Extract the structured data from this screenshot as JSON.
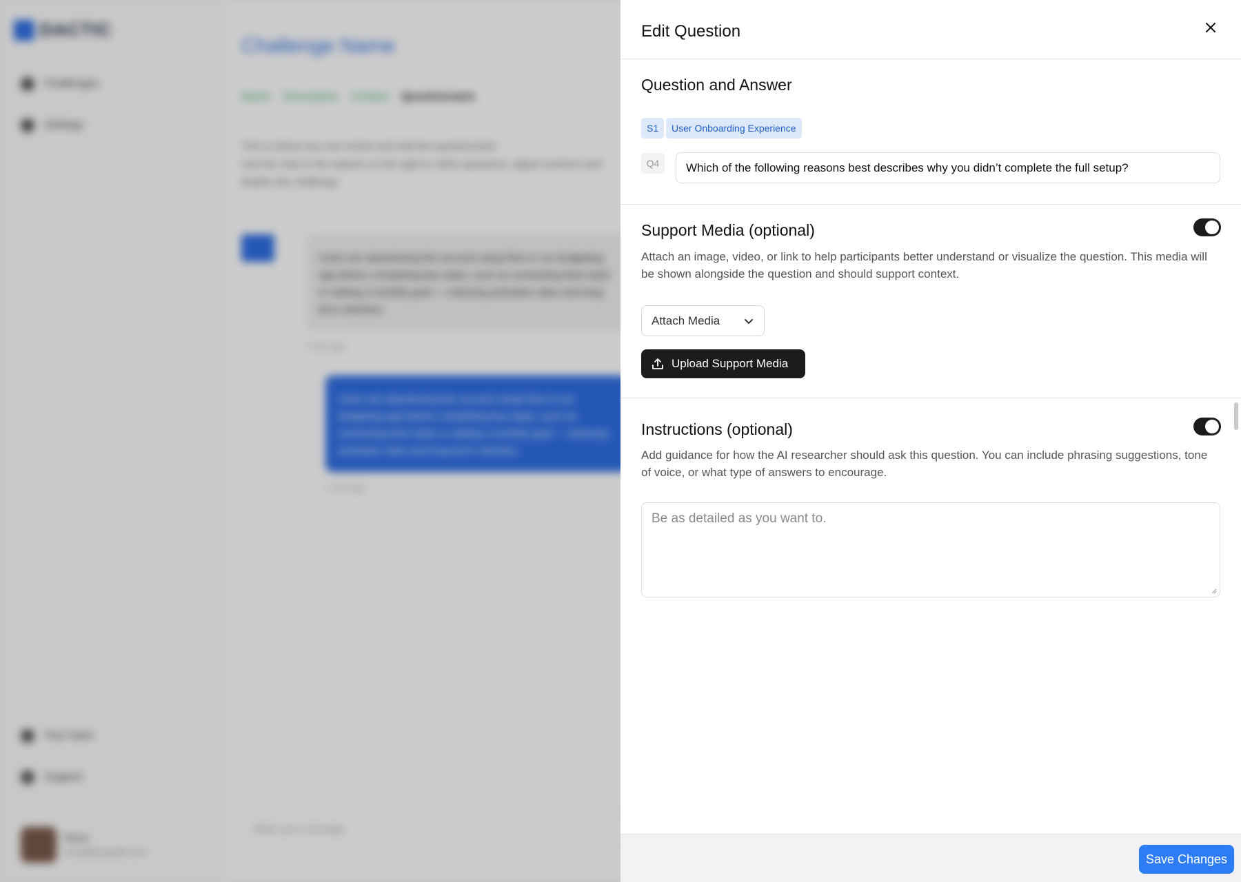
{
  "background": {
    "logo_text": "DACTIC",
    "nav_challenges": "Challenges",
    "nav_settings": "Settings",
    "nav_team": "Your team",
    "nav_support": "Support",
    "user_name": "Erica",
    "user_email": "erica@example.com",
    "page_title": "Challenge Name",
    "steps": [
      "Name",
      "Description",
      "Context",
      "Questionnaire"
    ],
    "desc_line1": "This is where you can review and edit the questionnaire.",
    "desc_line2": "Use the chat or the options on the right to refine questions, adjust sections and finalize the challenge.",
    "bot_message": "Users are abandoning the account setup flow in our budgeting app before completing key steps, such as connecting their bank or setting a monthly goal — reducing activation rates and long-term retention.",
    "user_message": "Users are abandoning the account setup flow in our budgeting app before completing key steps, such as connecting their bank or setting a monthly goal — reducing activation rates and long-term retention.",
    "time1": "1 min ago",
    "time2": "1 min ago",
    "input_placeholder": "Write your message"
  },
  "panel": {
    "title": "Edit Question",
    "close_icon": "close-icon"
  },
  "qa": {
    "title": "Question and Answer",
    "section_tag": "S1",
    "section_name": "User Onboarding Experience",
    "question_tag": "Q4",
    "question_text": "Which of the following reasons best describes why you didn’t complete the full setup?"
  },
  "media": {
    "title": "Support Media (optional)",
    "enabled": true,
    "description": "Attach an image, video, or link to help participants better understand or visualize the question. This media will be shown alongside the question and should support context.",
    "attach_select": "Attach Media",
    "upload_label": "Upload Support Media"
  },
  "instructions": {
    "title": "Instructions (optional)",
    "enabled": true,
    "description": "Add guidance for how the AI researcher should ask this question. You can include phrasing suggestions, tone of voice, or what type of answers to encourage.",
    "placeholder": "Be as detailed as you want to."
  },
  "footer": {
    "save_label": "Save Changes"
  },
  "colors": {
    "accent": "#2f7df6",
    "tag_bg": "#dde9fb",
    "tag_text": "#2060c8",
    "toggle_on": "#1c1c1e"
  }
}
